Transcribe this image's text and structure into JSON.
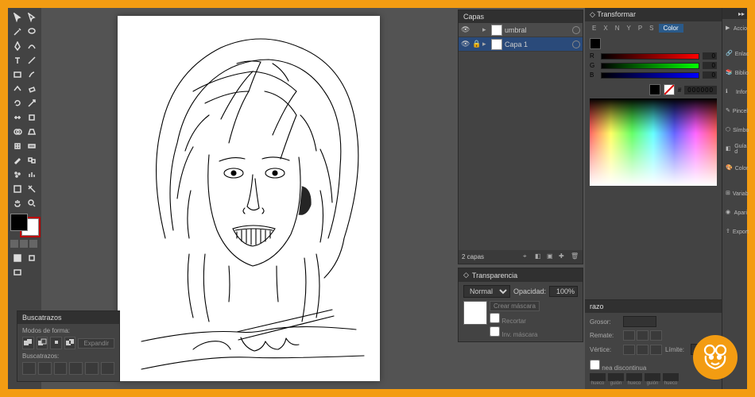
{
  "app": "Adobe Illustrator",
  "panels": {
    "transform": {
      "title": "Transformar"
    },
    "color": {
      "title": "Color",
      "modes": [
        "E",
        "X",
        "N",
        "Y",
        "P",
        "S",
        "C"
      ],
      "r": 0,
      "g": 0,
      "b": 0,
      "hex": "000000"
    },
    "layers": {
      "title": "Capas",
      "items": [
        {
          "name": "umbral",
          "visible": true,
          "locked": false
        },
        {
          "name": "Capa 1",
          "visible": true,
          "locked": true
        }
      ],
      "count_label": "2 capas"
    },
    "transparency": {
      "title": "Transparencia",
      "mode": "Normal",
      "opacity_label": "Opacidad:",
      "opacity": "100%",
      "make_mask": "Crear máscara",
      "clip": "Recortar",
      "invert": "Inv. máscara"
    },
    "stroke": {
      "title": "razo",
      "weight_label": "Grosor:",
      "caps_label": "Remate:",
      "corner_label": "Vértice:",
      "limit_label": "Límite:",
      "dash_title": "nea discontinua",
      "dash_labels": [
        "hueco",
        "guión",
        "hueco",
        "guión",
        "hueco"
      ]
    },
    "pathfinder": {
      "title": "Buscatrazos",
      "shape_modes": "Modos de forma:",
      "expand": "Expandir",
      "pf_label": "Buscatrazos:"
    }
  },
  "side_icons": [
    "Accio",
    "Enlac",
    "Biblio",
    "Infor",
    "Pincel",
    "Símbo",
    "Guía d",
    "Color",
    "Variab",
    "Apari",
    "Export"
  ]
}
